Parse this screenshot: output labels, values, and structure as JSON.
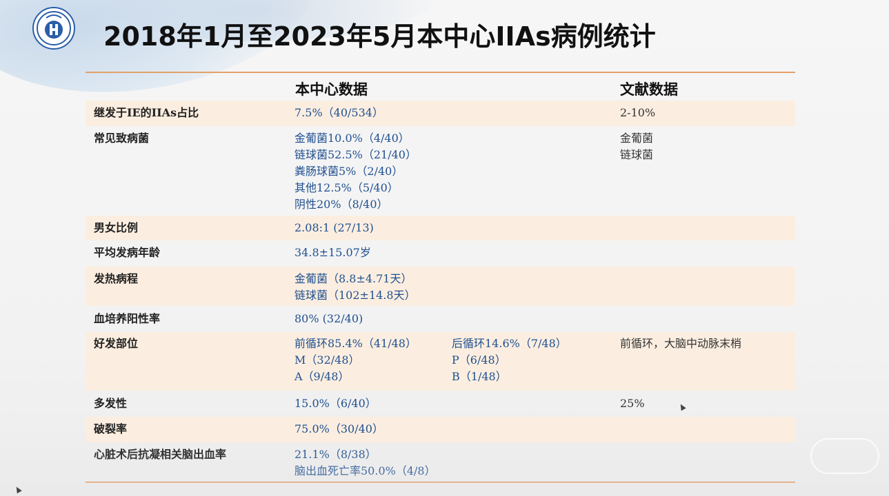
{
  "title": "2018年1月至2023年5月本中心IIAs病例统计",
  "columns": {
    "own": "本中心数据",
    "literature": "文献数据"
  },
  "rows": [
    {
      "label": "继发于IE的IIAs占比",
      "own": [
        "7.5%（40/534）"
      ],
      "own2": [],
      "lit": [
        "2-10%"
      ]
    },
    {
      "label": "常见致病菌",
      "own": [
        "金葡菌10.0%（4/40）",
        "链球菌52.5%（21/40）",
        "粪肠球菌5%（2/40）",
        "其他12.5%（5/40）",
        "阴性20%（8/40）"
      ],
      "own2": [],
      "lit": [
        "金葡菌",
        "链球菌"
      ]
    },
    {
      "label": "男女比例",
      "own": [
        "2.08:1 (27/13)"
      ],
      "own2": [],
      "lit": []
    },
    {
      "label": "平均发病年龄",
      "own": [
        "34.8±15.07岁"
      ],
      "own2": [],
      "lit": []
    },
    {
      "label": "发热病程",
      "own": [
        "金葡菌（8.8±4.71天）",
        "链球菌（102±14.8天）"
      ],
      "own2": [],
      "lit": []
    },
    {
      "label": "血培养阳性率",
      "own": [
        "80% (32/40)"
      ],
      "own2": [],
      "lit": []
    },
    {
      "label": "好发部位",
      "own": [
        "前循环85.4%（41/48）",
        "M（32/48）",
        "A（9/48）"
      ],
      "own2": [
        "后循环14.6%（7/48）",
        "P（6/48）",
        "B（1/48）"
      ],
      "lit": [
        "前循环，大脑中动脉末梢"
      ]
    },
    {
      "label": "多发性",
      "own": [
        "15.0%（6/40）"
      ],
      "own2": [],
      "lit": [
        "25%"
      ]
    },
    {
      "label": "破裂率",
      "own": [
        "75.0%（30/40）"
      ],
      "own2": [],
      "lit": []
    },
    {
      "label": "心脏术后抗凝相关脑出血率",
      "own": [
        "21.1%（8/38）",
        "脑出血死亡率50.0%（4/8）"
      ],
      "own2": [],
      "lit": []
    }
  ],
  "colors": {
    "rule": "#e3a06a",
    "shade": "#fbeee0",
    "own_text": "#1f4f8f",
    "logo": "#2a5ea8"
  },
  "icons": {
    "logo": "hospital-emblem",
    "cursor": "mouse-pointer"
  }
}
